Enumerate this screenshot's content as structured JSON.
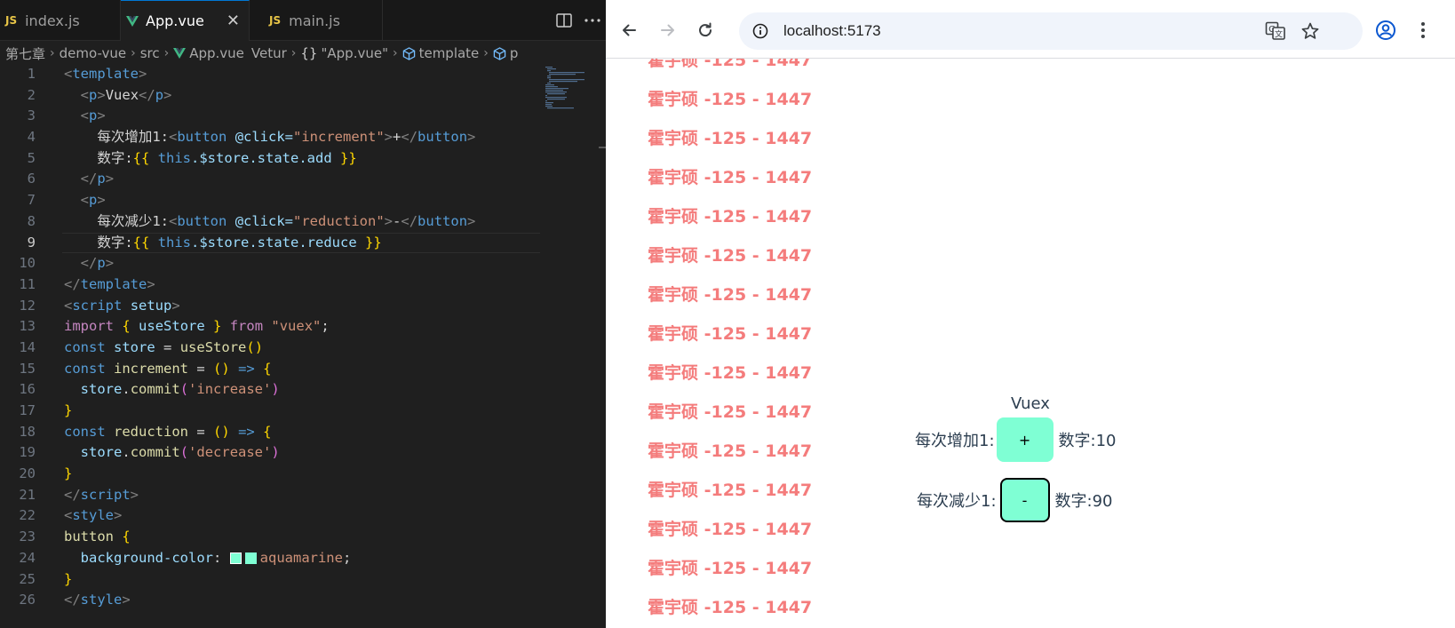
{
  "editor": {
    "tabs": [
      {
        "label": "index.js",
        "type": "js",
        "active": false
      },
      {
        "label": "App.vue",
        "type": "vue",
        "active": true
      },
      {
        "label": "main.js",
        "type": "js",
        "active": false
      }
    ],
    "breadcrumb": {
      "folder": "第七章",
      "project": "demo-vue",
      "src": "src",
      "file": "App.vue",
      "ext": "Vetur",
      "scope": "\"App.vue\"",
      "node": "template",
      "leaf": "p"
    },
    "line_numbers": [
      "1",
      "2",
      "3",
      "4",
      "5",
      "6",
      "7",
      "8",
      "9",
      "10",
      "11",
      "12",
      "13",
      "14",
      "15",
      "16",
      "17",
      "18",
      "19",
      "20",
      "21",
      "22",
      "23",
      "24",
      "25",
      "26"
    ],
    "code": {
      "l1": "template",
      "l2_tag": "p",
      "l2_text": "Vuex",
      "l3_tag": "p",
      "l4_text": "每次增加1:",
      "l4_tag": "button",
      "l4_attr": "@click=",
      "l4_val": "\"increment\"",
      "l4_inner": "+",
      "l5_text": "数字:",
      "l5_this": "this",
      "l5_expr": ".$store.state.add",
      "l7_tag": "p",
      "l8_text": "每次减少1:",
      "l8_tag": "button",
      "l8_attr": "@click=",
      "l8_val": "\"reduction\"",
      "l8_inner": "-",
      "l9_text": "数字:",
      "l9_this": "this",
      "l9_expr": ".$store.state.reduce",
      "l11": "template",
      "l12_tag": "script",
      "l12_attr": "setup",
      "l13_import": "import",
      "l13_name": "useStore",
      "l13_from": "from",
      "l13_mod": "\"vuex\"",
      "l14_const": "const",
      "l14_var": "store",
      "l14_fn": "useStore",
      "l15_const": "const",
      "l15_var": "increment",
      "l16_obj": "store",
      "l16_fn": "commit",
      "l16_arg": "'increase'",
      "l18_const": "const",
      "l18_var": "reduction",
      "l19_obj": "store",
      "l19_fn": "commit",
      "l19_arg": "'decrease'",
      "l21": "script",
      "l22": "style",
      "l23_sel": "button",
      "l24_prop": "background-color",
      "l24_val": "aquamarine",
      "l26": "style"
    },
    "swatch_color": "#7fffd4"
  },
  "browser": {
    "url": "localhost:5173",
    "icons": [
      "back-icon",
      "forward-icon",
      "reload-icon",
      "site-info-icon",
      "translate-icon",
      "bookmark-star-icon",
      "profile-icon",
      "menu-icon"
    ],
    "watermark": "霍宇硕 -125 - 1447",
    "watermark_color": "#f47c7c",
    "app": {
      "title": "Vuex",
      "inc_label": "每次增加1:",
      "inc_button": "+",
      "inc_value": "数字:10",
      "dec_label": "每次减少1:",
      "dec_button": "-",
      "dec_value": "数字:90",
      "button_color": "#7fffd4"
    }
  }
}
